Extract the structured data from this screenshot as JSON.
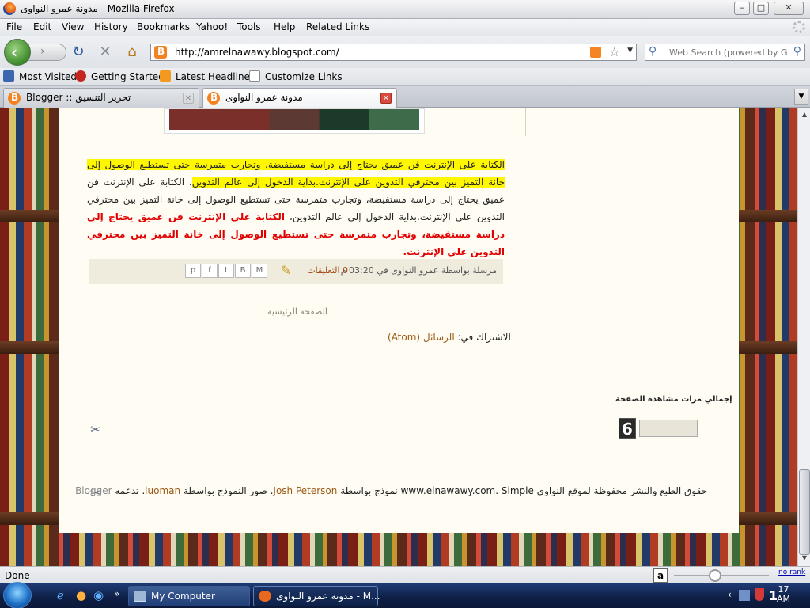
{
  "window": {
    "title": "مدونة عمرو النواوى - Mozilla Firefox",
    "minimize": "–",
    "maximize": "□",
    "close": "✕"
  },
  "menu": [
    "File",
    "Edit",
    "View",
    "History",
    "Bookmarks",
    "Yahoo!",
    "Tools",
    "Help",
    "Related Links"
  ],
  "nav": {
    "back_glyph": "‹",
    "forward_glyph": "›",
    "reload_glyph": "↻",
    "stop_glyph": "✕",
    "home_glyph": "⌂",
    "url": "http://amrelnawawy.blogspot.com/",
    "search_placeholder": "Web Search (powered by Go"
  },
  "bookmarks": [
    "Most Visited",
    "Getting Started",
    "Latest Headlines",
    "Customize Links"
  ],
  "tabs": [
    {
      "label": "Blogger :: تحرير التنسيق",
      "active": false
    },
    {
      "label": "مدونة عمرو النواوى",
      "active": true
    }
  ],
  "post": {
    "p1": "الكتابة على الإنترنت فن عميق يحتاج إلى دراسة مستفيضة، وتجارب متمرسة حتى تستطيع الوصول إلى خانة التميز بين محترفي التدوين على الإنترنت.بداية الدخول إلى عالم التدوين",
    "p2": "، الكتابة على الإنترنت فن عميق يحتاج إلى دراسة مستفيضة، وتجارب متمرسة حتى تستطيع الوصول إلى خانة التميز بين محترفي التدوين على الإنترنت.بداية الدخول إلى عالم التدوين، ",
    "p3": "الكتابة على الإنترنت فن عميق يحتاج إلى دراسة مستفيضة، وتجارب متمرسة حتى تستطيع الوصول إلى خانة التميز بين محترفي التدوين على الإنترنت.",
    "posted_by": "مرسلة بواسطة عمرو النواوى في 03:20 م",
    "comments": "0 التعليقات",
    "share_buttons": [
      "M",
      "B",
      "t",
      "f",
      "p"
    ]
  },
  "home_link": "الصفحة الرئيسية",
  "subscribe": {
    "label": "الاشتراك في: ",
    "link": "الرسائل (Atom)"
  },
  "counter": {
    "title": "إجمالي مرات مشاهدة الصفحة",
    "digit": "6"
  },
  "footer": {
    "part1": "حقوق الطبع والنشر محفوظة لموقع النواوى www.elnawawy.com. Simple نموذج بواسطة ",
    "link1": "Josh Peterson",
    "part2": ". صور النموذج بواسطة ",
    "link2": "luoman",
    "part3": ". تدعمه ",
    "blogger": "Blogger"
  },
  "status": {
    "text": "Done",
    "rank": "no rank"
  },
  "taskbar": {
    "items": [
      {
        "label": "My Computer",
        "active": false
      },
      {
        "label": "مدونة عمرو النواوى - M...",
        "active": true
      }
    ],
    "time": "17",
    "ampm": "AM",
    "extra": "1"
  },
  "colors": {
    "highlight": "#fff700",
    "red_text": "#e00000",
    "link": "#9b5a15"
  }
}
